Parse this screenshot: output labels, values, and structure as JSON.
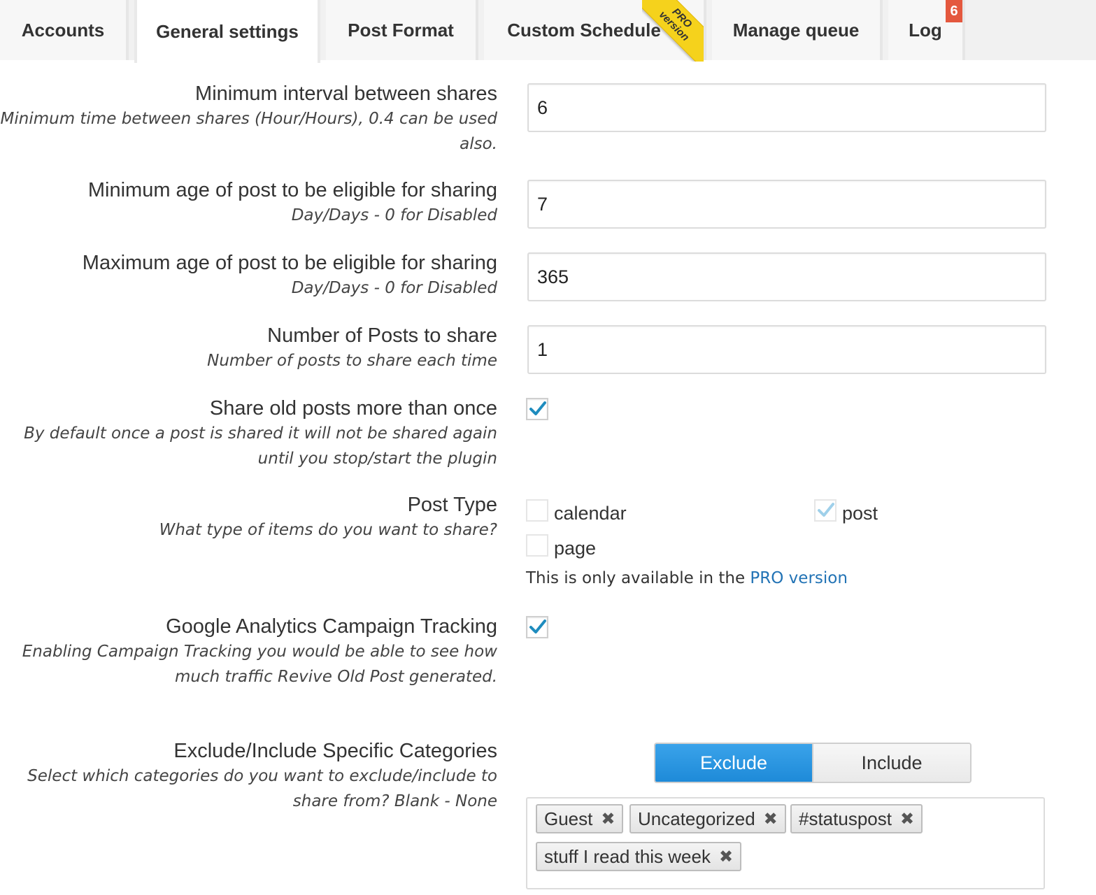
{
  "tabs": [
    {
      "label": "Accounts"
    },
    {
      "label": "General settings"
    },
    {
      "label": "Post Format"
    },
    {
      "label": "Custom Schedule",
      "ribbon_line1": "PRO",
      "ribbon_line2": "version"
    },
    {
      "label": "Manage queue"
    },
    {
      "label": "Log",
      "badge": "6"
    }
  ],
  "fields": {
    "min_interval": {
      "title": "Minimum interval between shares",
      "desc1": "Minimum time between shares (Hour/Hours), 0.4 can be used",
      "desc2": "also.",
      "value": "6"
    },
    "min_age": {
      "title": "Minimum age of post to be eligible for sharing",
      "desc": "Day/Days - 0 for Disabled",
      "value": "7"
    },
    "max_age": {
      "title": "Maximum age of post to be eligible for sharing",
      "desc": "Day/Days - 0 for Disabled",
      "value": "365"
    },
    "num_posts": {
      "title": "Number of Posts to share",
      "desc": "Number of posts to share each time",
      "value": "1"
    },
    "share_more": {
      "title": "Share old posts more than once",
      "desc1": "By default once a post is shared it will not be shared again",
      "desc2": "until you stop/start the plugin",
      "checked": true
    },
    "post_type": {
      "title": "Post Type",
      "desc": "What type of items do you want to share?",
      "options": [
        {
          "label": "calendar",
          "checked": false
        },
        {
          "label": "post",
          "checked": true
        },
        {
          "label": "page",
          "checked": false
        }
      ],
      "pro_note": "This is only available in the ",
      "pro_link": "PRO version"
    },
    "ga_tracking": {
      "title": "Google Analytics Campaign Tracking",
      "desc1": "Enabling Campaign Tracking you would be able to see how",
      "desc2": "much traffic Revive Old Post generated.",
      "checked": true
    },
    "categories": {
      "title": "Exclude/Include Specific Categories",
      "desc1": "Select which categories do you want to exclude/include to",
      "desc2": "share from? Blank - None",
      "toggle": {
        "exclude": "Exclude",
        "include": "Include",
        "selected": "Exclude"
      },
      "tags": [
        "Guest",
        "Uncategorized",
        "#statuspost",
        "stuff I read this week"
      ]
    }
  },
  "colors": {
    "accent": "#1e8ad8",
    "check": "#1e8cbe",
    "badge": "#e4583e",
    "ribbon": "#f5d21c",
    "link": "#2273b5"
  }
}
